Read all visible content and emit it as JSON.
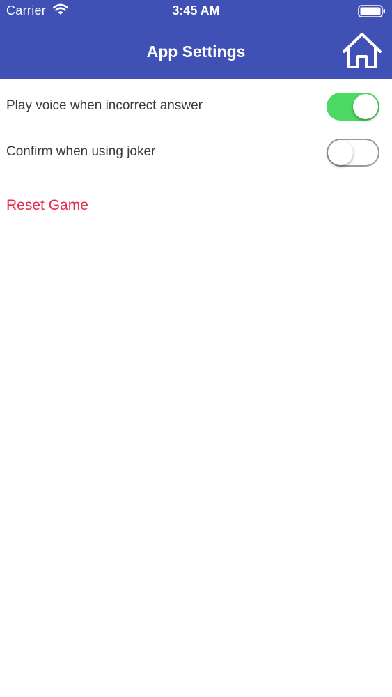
{
  "status_bar": {
    "carrier": "Carrier",
    "time": "3:45 AM",
    "wifi_icon": "wifi-icon",
    "battery_icon": "battery-icon"
  },
  "nav": {
    "title": "App Settings",
    "home_icon": "home-icon",
    "background_color": "#3f51b5"
  },
  "settings": {
    "items": [
      {
        "label": "Play voice when incorrect answer",
        "enabled": true
      },
      {
        "label": "Confirm when using joker",
        "enabled": false
      }
    ],
    "toggle_on_color": "#4cd964"
  },
  "reset": {
    "label": "Reset Game",
    "color": "#e8294a"
  }
}
